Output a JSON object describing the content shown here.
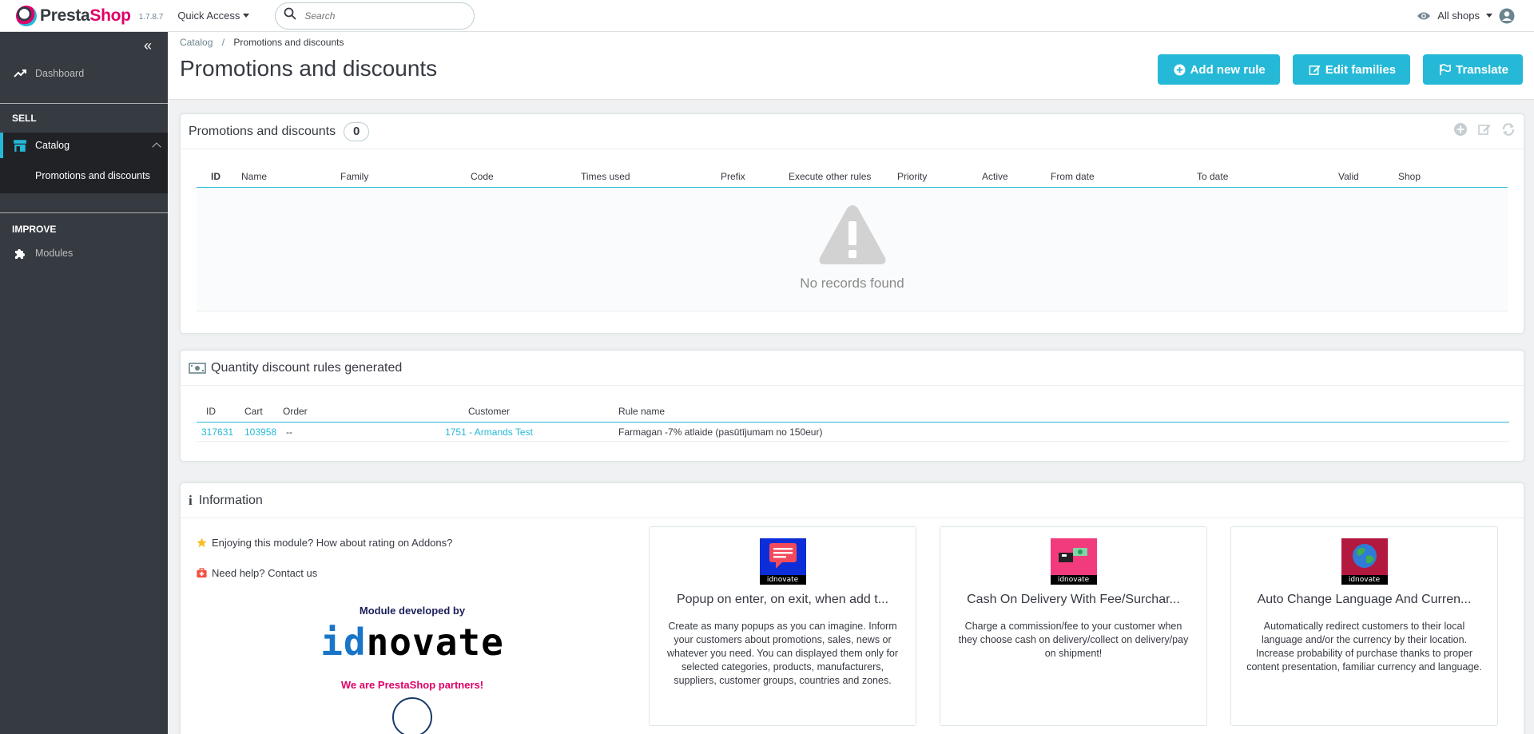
{
  "header": {
    "brand_part1": "Presta",
    "brand_part2": "Shop",
    "version": "1.7.8.7",
    "quick_access": "Quick Access",
    "search_placeholder": "Search",
    "all_shops": "All shops"
  },
  "sidebar": {
    "dashboard": "Dashboard",
    "sell_title": "SELL",
    "catalog": "Catalog",
    "catalog_sub": "Promotions and discounts",
    "improve_title": "IMPROVE",
    "modules": "Modules"
  },
  "page": {
    "breadcrumb_parent": "Catalog",
    "breadcrumb_sep": "/",
    "breadcrumb_current": "Promotions and discounts",
    "title": "Promotions and discounts",
    "actions": {
      "add_rule": "Add new rule",
      "edit_families": "Edit families",
      "translate": "Translate"
    }
  },
  "rules_panel": {
    "title": "Promotions and discounts",
    "count": "0",
    "columns": [
      "ID",
      "Name",
      "Family",
      "Code",
      "Times used",
      "Prefix",
      "Execute other rules",
      "Priority",
      "Active",
      "From date",
      "To date",
      "Valid",
      "Shop"
    ],
    "empty_message": "No records found"
  },
  "generated_panel": {
    "title": "Quantity discount rules generated",
    "columns": [
      "ID",
      "Cart",
      "Order",
      "Customer",
      "Rule name"
    ],
    "rows": [
      {
        "id": "317631",
        "cart": "103958",
        "order": "--",
        "customer": "1751 - Armands Test",
        "rule_name": "Farmagan -7% atlaide (pasūtījumam no 150eur)"
      }
    ]
  },
  "info_panel": {
    "title": "Information",
    "rating_text": "Enjoying this module? How about rating on Addons?",
    "help_text": "Need help? Contact us",
    "developed_by": "Module developed by",
    "dev_logo_a": "id",
    "dev_logo_b": "novate",
    "partners": "We are PrestaShop partners!",
    "cards": [
      {
        "brand": "idnovate",
        "title": "Popup on enter, on exit, when add t...",
        "desc": "Create as many popups as you can imagine. Inform your customers about promotions, sales, news or whatever you need. You can displayed them only for selected categories, products, manufacturers, suppliers, customer groups, countries and zones."
      },
      {
        "brand": "idnovate",
        "title": "Cash On Delivery With Fee/Surchar...",
        "desc": "Charge a commission/fee to your customer when they choose cash on delivery/collect on delivery/pay on shipment!"
      },
      {
        "brand": "idnovate",
        "title": "Auto Change Language And Curren...",
        "desc": "Automatically redirect customers to their local language and/or the currency by their location. Increase probability of purchase thanks to proper content presentation, familiar currency and language."
      }
    ]
  },
  "colors": {
    "accent": "#25b9d7",
    "sidebar_bg": "#363a41",
    "brand_pink": "#df0067"
  }
}
